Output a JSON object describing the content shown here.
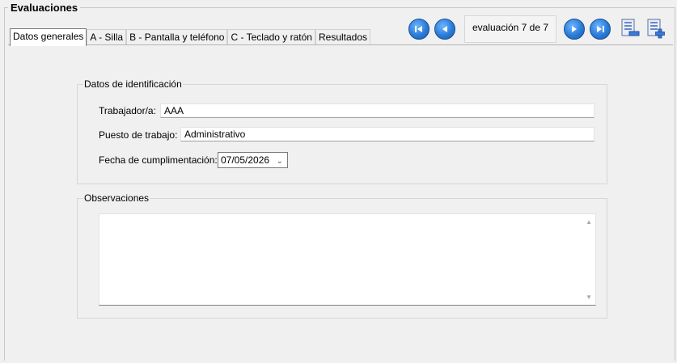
{
  "group": {
    "title": "Evaluaciones"
  },
  "tabs": [
    {
      "label": "Datos generales",
      "active": true
    },
    {
      "label": "A - Silla",
      "active": false
    },
    {
      "label": "B - Pantalla y teléfono",
      "active": false
    },
    {
      "label": "C - Teclado y ratón",
      "active": false
    },
    {
      "label": "Resultados",
      "active": false
    }
  ],
  "navigator": {
    "counter_text": "evaluación 7 de 7"
  },
  "identification": {
    "legend": "Datos de identificación",
    "worker_label": "Trabajador/a:",
    "worker_value": "AAA",
    "position_label": "Puesto de trabajo:",
    "position_value": "Administrativo",
    "date_label": "Fecha de cumplimentación:",
    "date_value": "07/05/2026"
  },
  "observations": {
    "legend": "Observaciones",
    "value": ""
  },
  "colors": {
    "nav_button": "#2a7bd8",
    "background": "#f0f0f0"
  }
}
